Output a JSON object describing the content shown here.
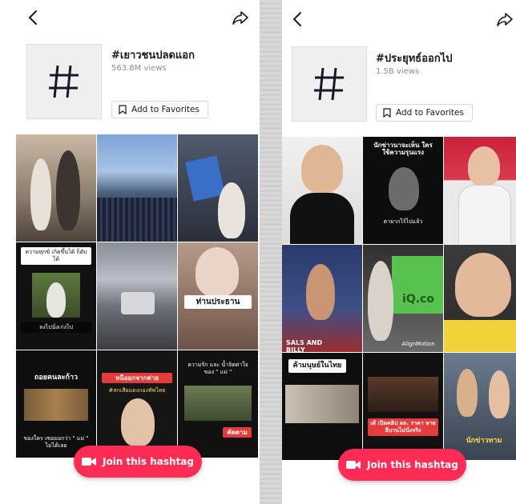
{
  "left": {
    "hashtag": "#เยาวชนปลดแอก",
    "views": "563.8M views",
    "fav_label": "Add to Favorites",
    "join_label": "Join this hashtag",
    "captions": {
      "t4": "ความทุกข์ เกิดขึ้นได้ ก็ดับได้",
      "t4b": "ลงไปนั่งเก่งไป",
      "t6": "ท่านประธาน",
      "t7": "ถอยคนละก้าว",
      "t7b": "ของใคร เซอมอกว่า \" แม่ \" ไม่ได้เลย",
      "t8": "หนีออกจากค่าย",
      "t8b": "#สกเสียแดงกองทัพไทย",
      "t9": "ความรัก และ น้ำจิตต่าใจ ของ \" แม่ \"",
      "t9b": "คัดตาม"
    }
  },
  "right": {
    "hashtag": "#ประยุทธ์ออกไป",
    "views": "1.5B views",
    "fav_label": "Add to Favorites",
    "join_label": "Join this hashtag",
    "captions": {
      "r2": "นักข่าวนาจะเห็น ใครใช้ความรุนแรง",
      "r2b": "ตายากไร้ไปแล้ว",
      "r4": "SALS AND BILLY",
      "r5": "iQ.co",
      "r5b": "AlignMotion",
      "r7": "ค้ามนุษย์ในไทย",
      "r8": "เด้ เปิดคลิป ผล. ราคา หายอีบานไม่นั่งจริง",
      "r9": "นักข่าวทาม"
    }
  },
  "colors": {
    "accent": "#fe2c55",
    "text": "#161823",
    "muted": "#8a8b91"
  }
}
